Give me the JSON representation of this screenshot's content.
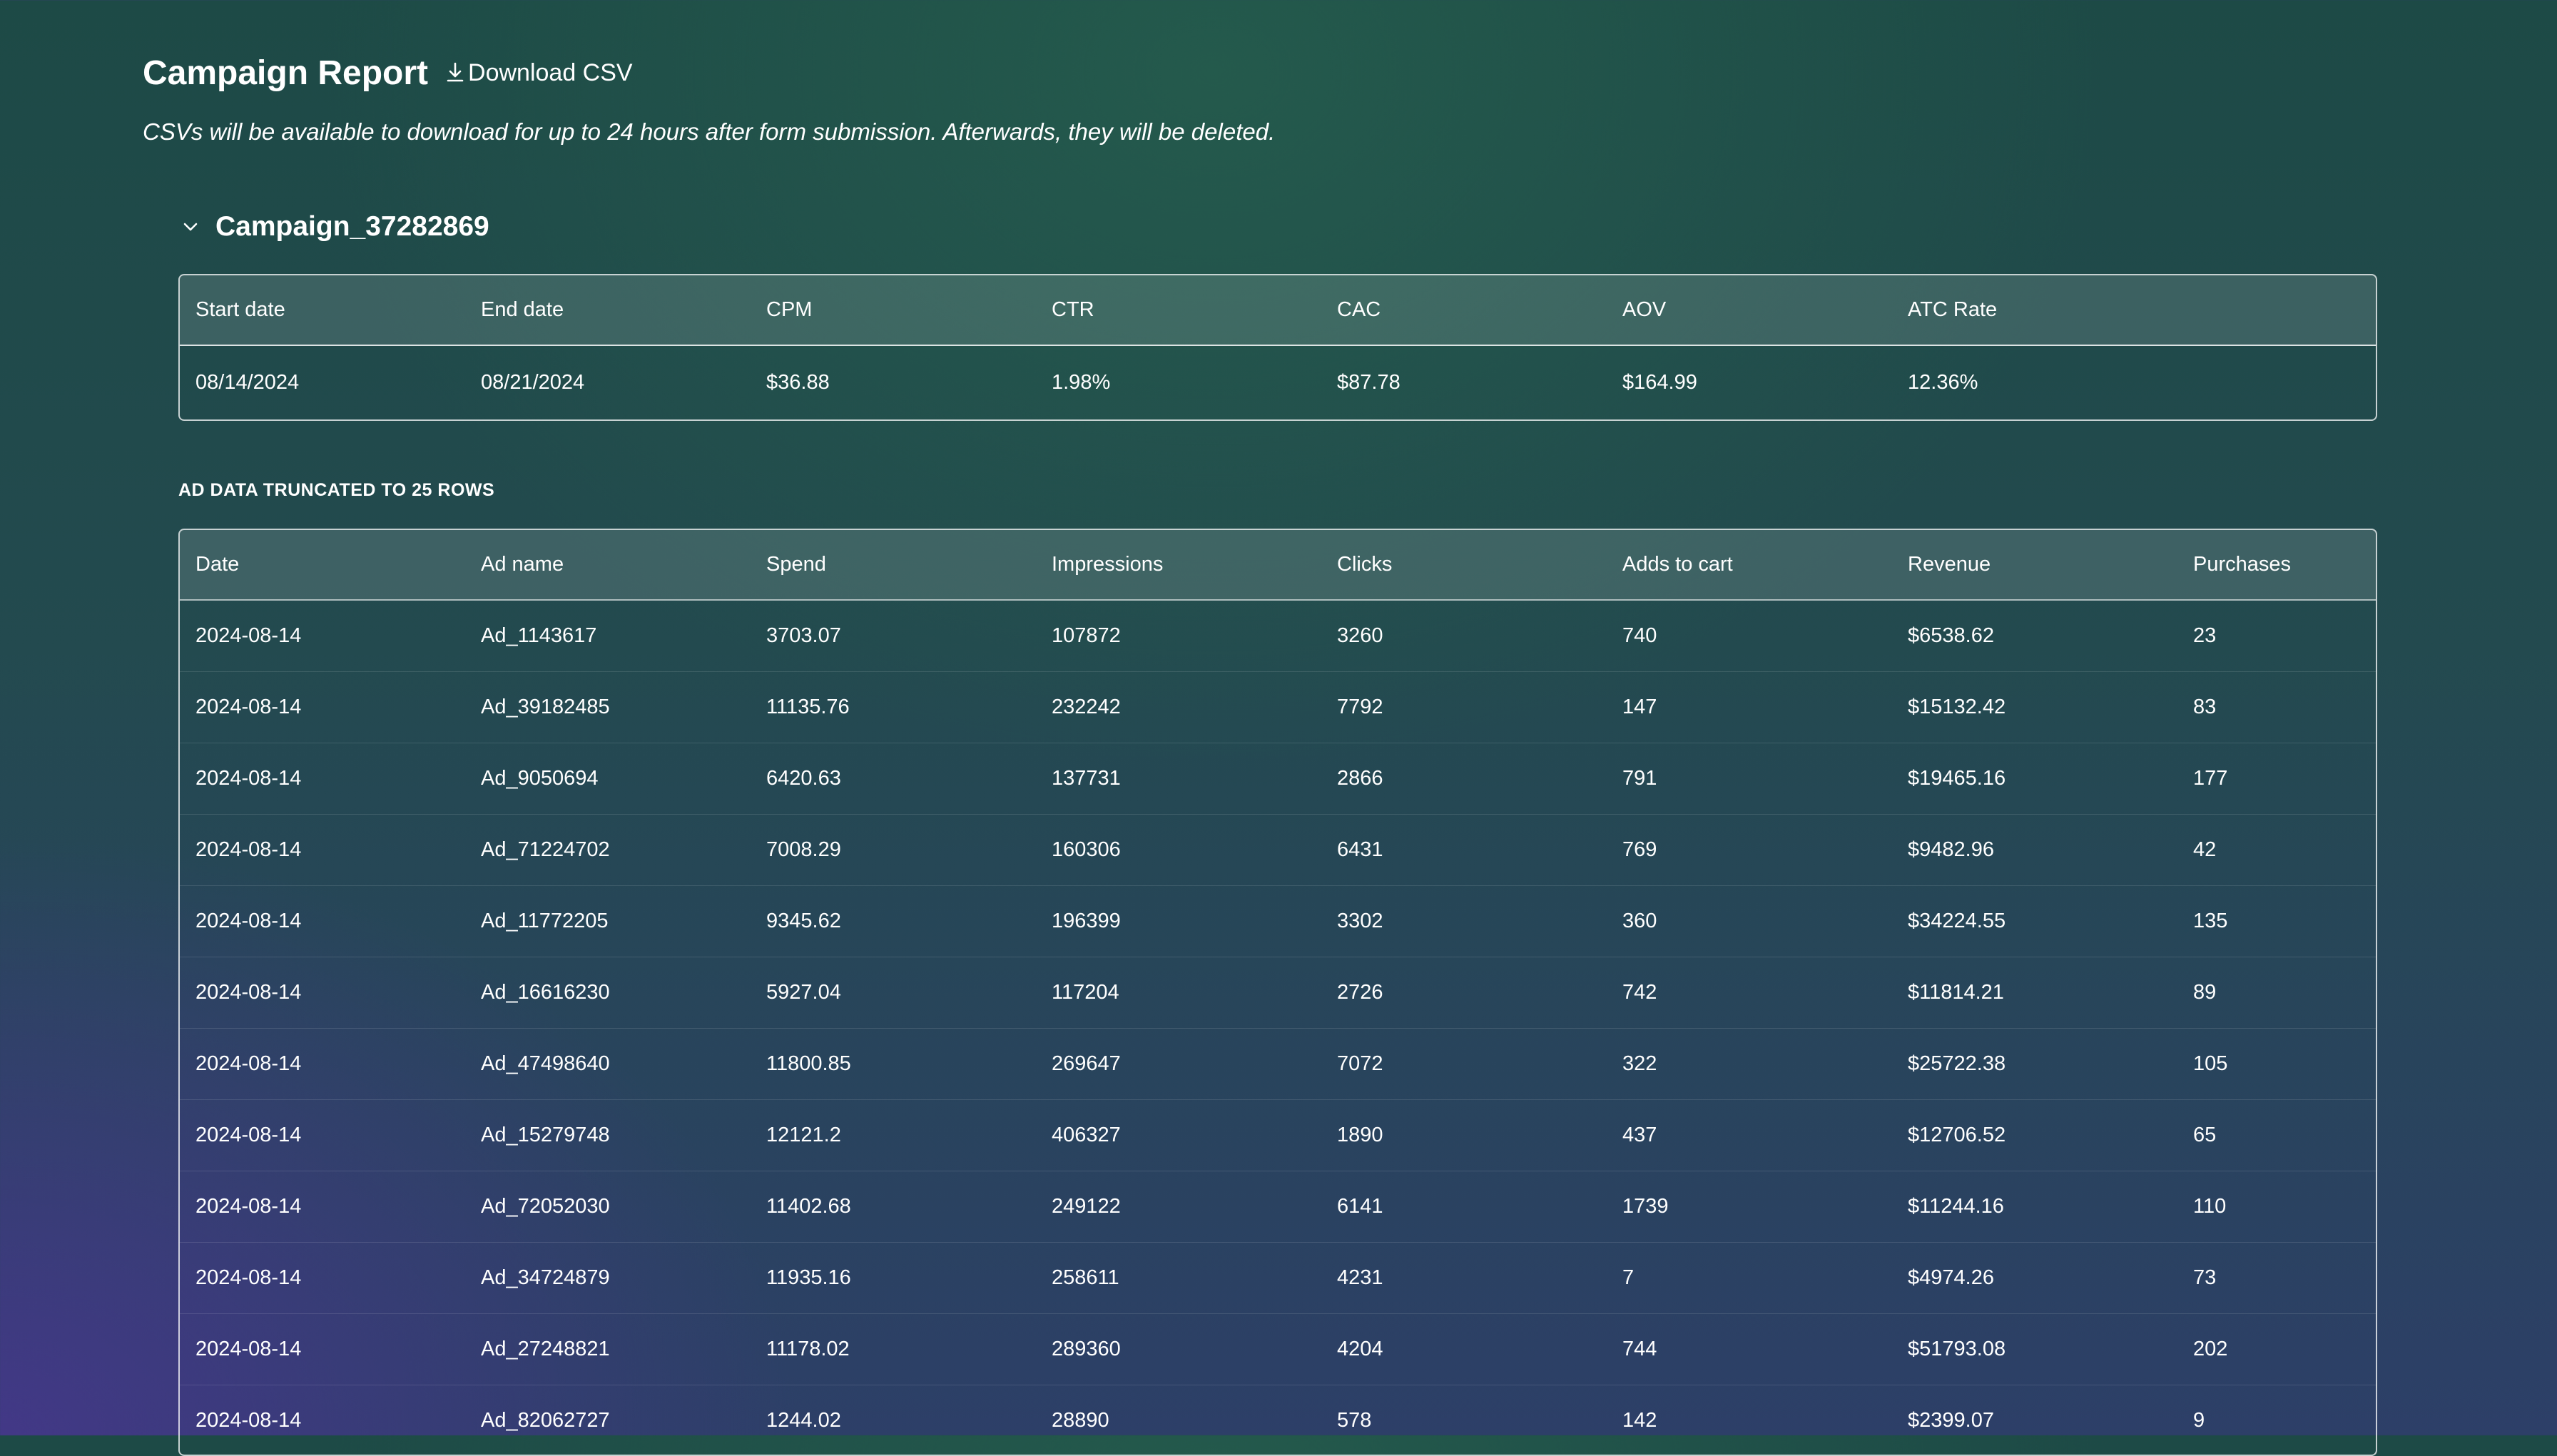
{
  "header": {
    "title": "Campaign Report",
    "download_label": "Download CSV",
    "download_icon": "download-icon",
    "subtitle": "CSVs will be available to download for up to 24 hours after form submission. Afterwards, they will be deleted."
  },
  "campaign": {
    "name": "Campaign_37282869",
    "toggle_icon": "chevron-down-icon",
    "summary": {
      "headers": [
        "Start date",
        "End date",
        "CPM",
        "CTR",
        "CAC",
        "AOV",
        "ATC Rate"
      ],
      "values": [
        "08/14/2024",
        "08/21/2024",
        "$36.88",
        "1.98%",
        "$87.78",
        "$164.99",
        "12.36%"
      ]
    }
  },
  "ads": {
    "truncated_label": "AD DATA TRUNCATED TO 25 ROWS",
    "headers": [
      "Date",
      "Ad name",
      "Spend",
      "Impressions",
      "Clicks",
      "Adds to cart",
      "Revenue",
      "Purchases"
    ],
    "rows": [
      [
        "2024-08-14",
        "Ad_1143617",
        "3703.07",
        "107872",
        "3260",
        "740",
        "$6538.62",
        "23"
      ],
      [
        "2024-08-14",
        "Ad_39182485",
        "11135.76",
        "232242",
        "7792",
        "147",
        "$15132.42",
        "83"
      ],
      [
        "2024-08-14",
        "Ad_9050694",
        "6420.63",
        "137731",
        "2866",
        "791",
        "$19465.16",
        "177"
      ],
      [
        "2024-08-14",
        "Ad_71224702",
        "7008.29",
        "160306",
        "6431",
        "769",
        "$9482.96",
        "42"
      ],
      [
        "2024-08-14",
        "Ad_11772205",
        "9345.62",
        "196399",
        "3302",
        "360",
        "$34224.55",
        "135"
      ],
      [
        "2024-08-14",
        "Ad_16616230",
        "5927.04",
        "117204",
        "2726",
        "742",
        "$11814.21",
        "89"
      ],
      [
        "2024-08-14",
        "Ad_47498640",
        "11800.85",
        "269647",
        "7072",
        "322",
        "$25722.38",
        "105"
      ],
      [
        "2024-08-14",
        "Ad_15279748",
        "12121.2",
        "406327",
        "1890",
        "437",
        "$12706.52",
        "65"
      ],
      [
        "2024-08-14",
        "Ad_72052030",
        "11402.68",
        "249122",
        "6141",
        "1739",
        "$11244.16",
        "110"
      ],
      [
        "2024-08-14",
        "Ad_34724879",
        "11935.16",
        "258611",
        "4231",
        "7",
        "$4974.26",
        "73"
      ],
      [
        "2024-08-14",
        "Ad_27248821",
        "11178.02",
        "289360",
        "4204",
        "744",
        "$51793.08",
        "202"
      ],
      [
        "2024-08-14",
        "Ad_82062727",
        "1244.02",
        "28890",
        "578",
        "142",
        "$2399.07",
        "9"
      ]
    ]
  }
}
